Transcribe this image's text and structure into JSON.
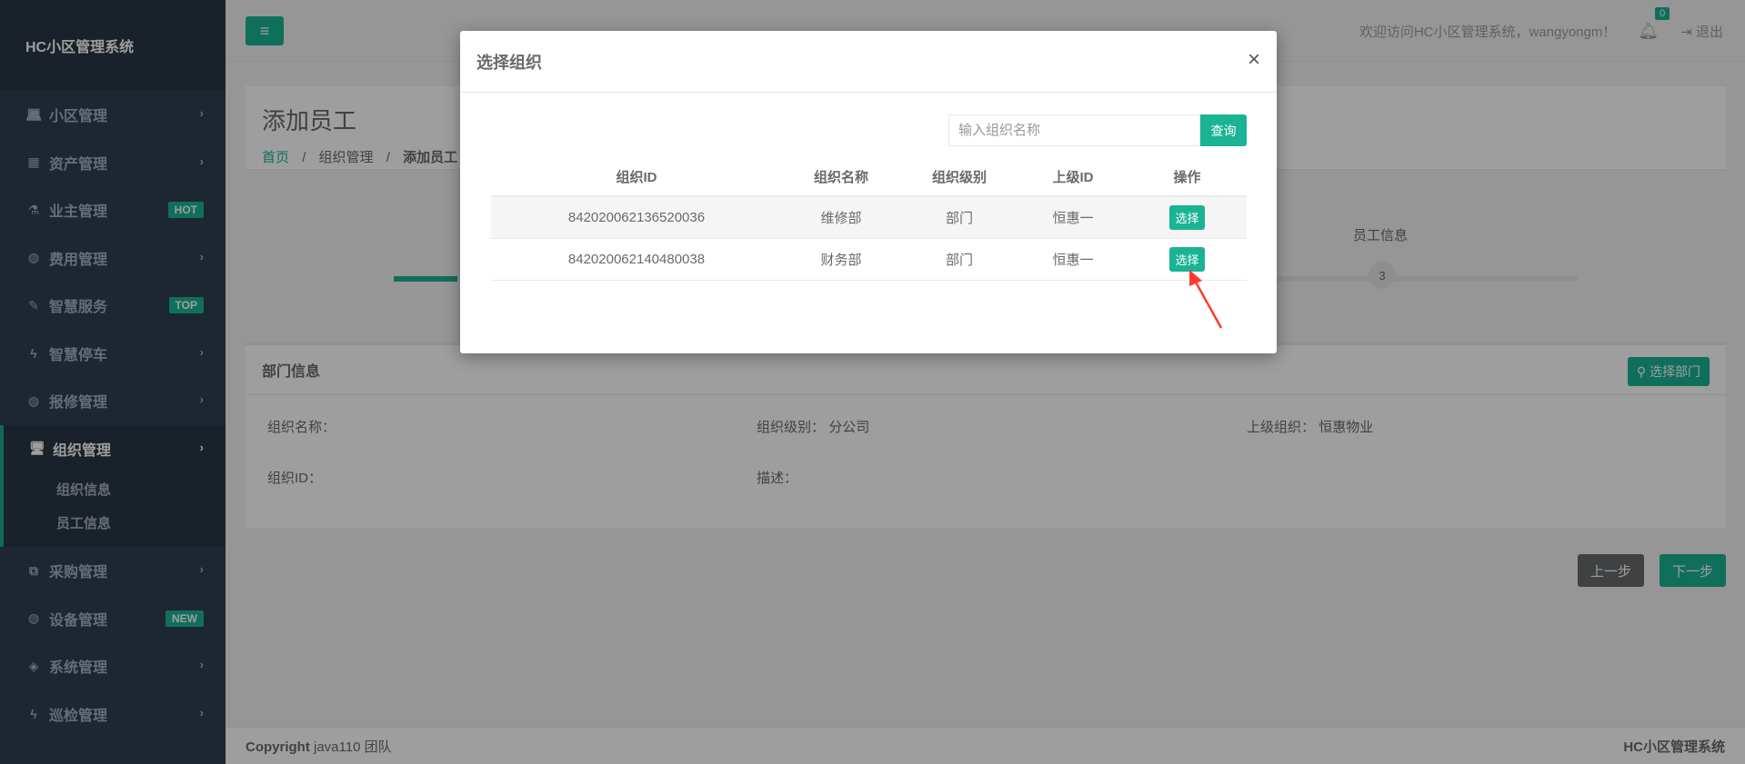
{
  "sidebar": {
    "brand": "HC小区管理系统",
    "items": [
      {
        "label": "小区管理",
        "icon": "laptop-icon",
        "glyph": "💻︎",
        "badge": ""
      },
      {
        "label": "资产管理",
        "icon": "grid-icon",
        "glyph": "▦",
        "badge": ""
      },
      {
        "label": "业主管理",
        "icon": "flask-icon",
        "glyph": "⚗︎",
        "badge": "HOT"
      },
      {
        "label": "费用管理",
        "icon": "globe-icon",
        "glyph": "◍",
        "badge": ""
      },
      {
        "label": "智慧服务",
        "icon": "edit-icon",
        "glyph": "✎",
        "badge": "TOP"
      },
      {
        "label": "智慧停车",
        "icon": "bolt-icon",
        "glyph": "ϟ",
        "badge": ""
      },
      {
        "label": "报修管理",
        "icon": "globe-icon",
        "glyph": "◍",
        "badge": ""
      }
    ],
    "active": {
      "label": "组织管理",
      "icon": "desktop-icon",
      "glyph": "🖥︎",
      "subitems": [
        "组织信息",
        "员工信息"
      ]
    },
    "items_after": [
      {
        "label": "采购管理",
        "icon": "copy-icon",
        "glyph": "⧉",
        "badge": ""
      },
      {
        "label": "设备管理",
        "icon": "globe-icon",
        "glyph": "◍",
        "badge": "NEW"
      },
      {
        "label": "系统管理",
        "icon": "diamond-icon",
        "glyph": "◈",
        "badge": ""
      },
      {
        "label": "巡检管理",
        "icon": "bolt-icon",
        "glyph": "ϟ",
        "badge": ""
      }
    ]
  },
  "topbar": {
    "welcome": "欢迎访问HC小区管理系统，wangyongm！",
    "notification_count": "0",
    "logout": "退出"
  },
  "heading": {
    "title": "添加员工",
    "breadcrumb": [
      "首页",
      "组织管理",
      "添加员工"
    ]
  },
  "steps": {
    "step3_label": "员工信息",
    "step3_number": "3"
  },
  "dept_panel": {
    "title": "部门信息",
    "choose_button": "选择部门",
    "org_name_label": "组织名称：",
    "org_level_label": "组织级别：",
    "org_level_value": "分公司",
    "parent_org_label": "上级组织：",
    "parent_org_value": "恒惠物业",
    "org_id_label": "组织ID：",
    "desc_label": "描述："
  },
  "nav_buttons": {
    "prev": "上一步",
    "next": "下一步"
  },
  "footer": {
    "copyright_bold": "Copyright",
    "copyright_text": "java110 团队",
    "right": "HC小区管理系统"
  },
  "modal": {
    "title": "选择组织",
    "close": "×",
    "search_placeholder": "输入组织名称",
    "search_button": "查询",
    "columns": [
      "组织ID",
      "组织名称",
      "组织级别",
      "上级ID",
      "操作"
    ],
    "rows": [
      {
        "id": "842020062136520036",
        "name": "维修部",
        "level": "部门",
        "parent": "恒惠一",
        "action": "选择"
      },
      {
        "id": "842020062140480038",
        "name": "财务部",
        "level": "部门",
        "parent": "恒惠一",
        "action": "选择"
      }
    ]
  },
  "colors": {
    "accent": "#1ab394",
    "sidebar": "#2f4050",
    "annotation_arrow": "#ff3b30"
  }
}
